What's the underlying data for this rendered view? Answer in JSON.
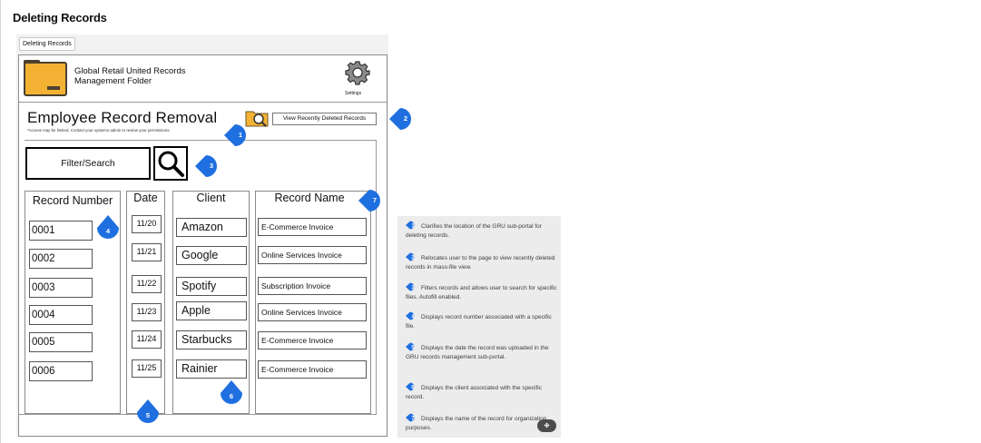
{
  "page": {
    "heading": "Deleting Records"
  },
  "tab": {
    "label": "Deleting Records"
  },
  "app": {
    "title_line1": "Global Retail United Records",
    "title_line2": "Management Folder",
    "settings_label": "Settings",
    "folder_icon": "folder-icon",
    "settings_icon": "gear-icon"
  },
  "form": {
    "title": "Employee Record Removal",
    "access_note": "*Access may be limited. Contact your systems admin to review your permissions.",
    "recent_button_label": "View Recently Deleted Records",
    "recent_icon": "folder-search-icon",
    "search_label": "Filter/Search",
    "search_icon": "magnifier-icon"
  },
  "table": {
    "headers": {
      "record_number": "Record Number",
      "date": "Date",
      "client": "Client",
      "record_name": "Record Name"
    },
    "rows": [
      {
        "record_number": "0001",
        "date": "11/20",
        "client": "Amazon",
        "record_name": "E-Commerce Invoice"
      },
      {
        "record_number": "0002",
        "date": "11/21",
        "client": "Google",
        "record_name": "Online Services Invoice"
      },
      {
        "record_number": "0003",
        "date": "11/22",
        "client": "Spotify",
        "record_name": "Subscription Invoice"
      },
      {
        "record_number": "0004",
        "date": "11/23",
        "client": "Apple",
        "record_name": "Online Services Invoice"
      },
      {
        "record_number": "0005",
        "date": "11/24",
        "client": "Starbucks",
        "record_name": "E-Commerce Invoice"
      },
      {
        "record_number": "0006",
        "date": "11/25",
        "client": "Rainier",
        "record_name": "E-Commerce Invoice"
      }
    ]
  },
  "markers": [
    "1",
    "2",
    "3",
    "4",
    "5",
    "6",
    "7"
  ],
  "legend": [
    {
      "num": "1",
      "text": "Clarifies the location of the GRU sub-portal for deleting records."
    },
    {
      "num": "2",
      "text": "Relocates user to the page to view recently deleted records in mass-file view."
    },
    {
      "num": "3",
      "text": "Filters records and allows user to search for specific files. Autofill enabled."
    },
    {
      "num": "4",
      "text": "Displays record number associated with a specific file."
    },
    {
      "num": "5",
      "text": "Displays the date the record was uploaded in the GRU records management sub-portal."
    },
    {
      "num": "6",
      "text": "Displays the client associated with the specific record."
    },
    {
      "num": "7",
      "text": "Displays the name of the record for organization purposes."
    }
  ],
  "edit_button_icon": "magic-wand-icon",
  "colors": {
    "marker_blue": "#1f6fe0",
    "folder_yellow": "#f3b233",
    "legend_bg": "#ececec"
  }
}
